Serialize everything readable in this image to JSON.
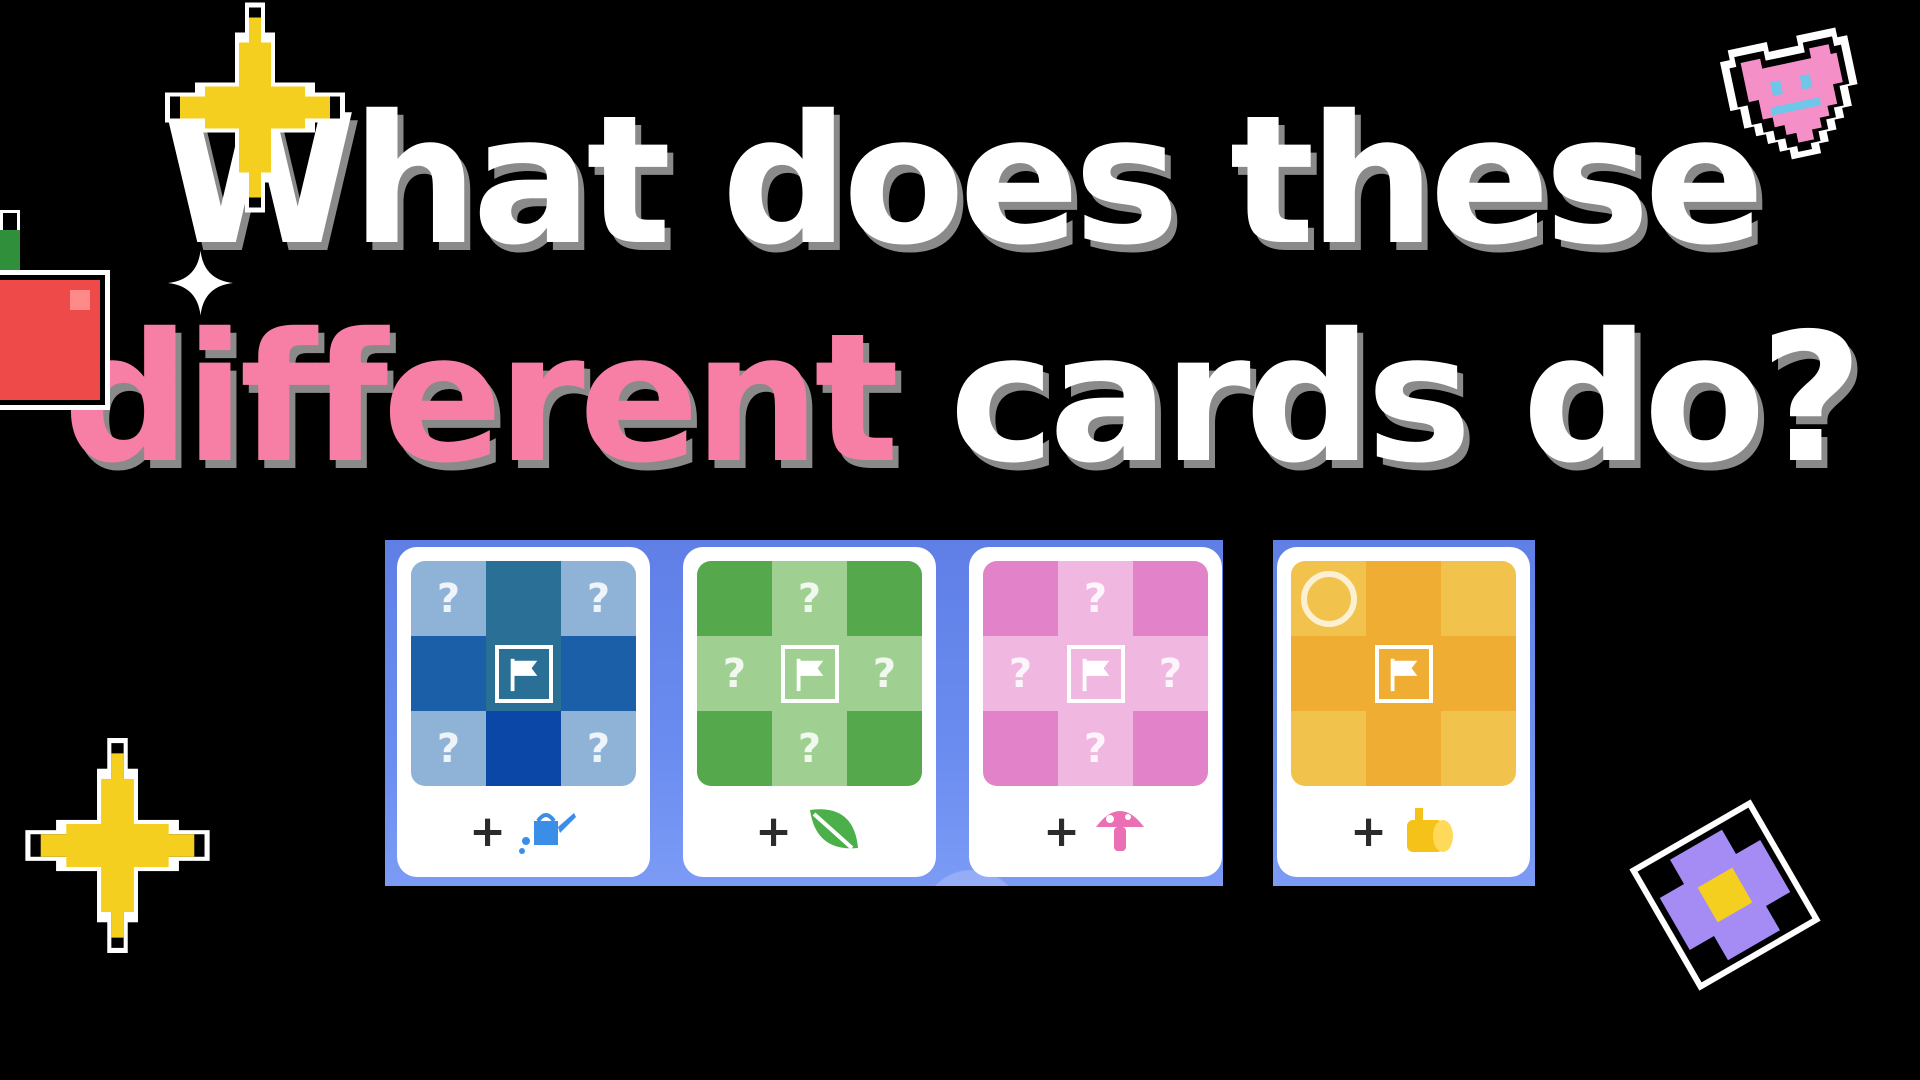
{
  "title": {
    "line1": "What does these",
    "line2_highlight": "different",
    "line2_rest": "cards do?"
  },
  "colors": {
    "background": "#000000",
    "title_text": "#ffffff",
    "highlight_text": "#f77fa6",
    "title_shadow": "#8a8a8a",
    "panel_blue": "#6a8cf0"
  },
  "decorations": [
    {
      "name": "pixel-sparkle-icon",
      "color": "#f5cf1f"
    },
    {
      "name": "white-sparkle-icon",
      "color": "#ffffff"
    },
    {
      "name": "pixel-heart-icon",
      "color": "#f48fc8"
    },
    {
      "name": "pixel-apple-icon",
      "color": "#ef4a4a"
    },
    {
      "name": "pixel-flower-icon",
      "color": "#a58cf5"
    }
  ],
  "cards": [
    {
      "name": "blue-card",
      "grid_colors": [
        "#8fb3d6",
        "#2a6f96",
        "#8fb3d6",
        "#1a5fa8",
        "#f0f0f0",
        "#1a5fa8",
        "#8fb3d6",
        "#0b47a6",
        "#8fb3d6"
      ],
      "marks": [
        "?",
        "",
        "?",
        "",
        "flag",
        "",
        "?",
        "",
        "?"
      ],
      "plus": "+",
      "icon": "watering-can-icon",
      "icon_color": "#3a8ee8"
    },
    {
      "name": "green-card",
      "grid_colors": [
        "#55a84c",
        "#9fd091",
        "#55a84c",
        "#9fd091",
        "#f0f0f0",
        "#9fd091",
        "#55a84c",
        "#9fd091",
        "#55a84c"
      ],
      "marks": [
        "",
        "?",
        "",
        "?",
        "flag",
        "?",
        "",
        "?",
        ""
      ],
      "plus": "+",
      "icon": "leaf-icon",
      "icon_color": "#4bb04a"
    },
    {
      "name": "pink-card",
      "grid_colors": [
        "#e283c9",
        "#f0b8e0",
        "#e283c9",
        "#f0b8e0",
        "#f0f0f0",
        "#f0b8e0",
        "#e283c9",
        "#f0b8e0",
        "#e283c9"
      ],
      "marks": [
        "",
        "?",
        "",
        "?",
        "flag",
        "?",
        "",
        "?",
        ""
      ],
      "plus": "+",
      "icon": "mushroom-icon",
      "icon_color": "#ea6fb4"
    },
    {
      "name": "yellow-card",
      "grid_colors": [
        "#f1c24c",
        "#efae33",
        "#f1c24c",
        "#efae33",
        "#f0f0f0",
        "#efae33",
        "#f1c24c",
        "#efae33",
        "#f1c24c"
      ],
      "marks": [
        "ring",
        "",
        "",
        "",
        "flag",
        "",
        "",
        "",
        ""
      ],
      "plus": "+",
      "icon": "wood-log-icon",
      "icon_color": "#f5c21a"
    }
  ]
}
